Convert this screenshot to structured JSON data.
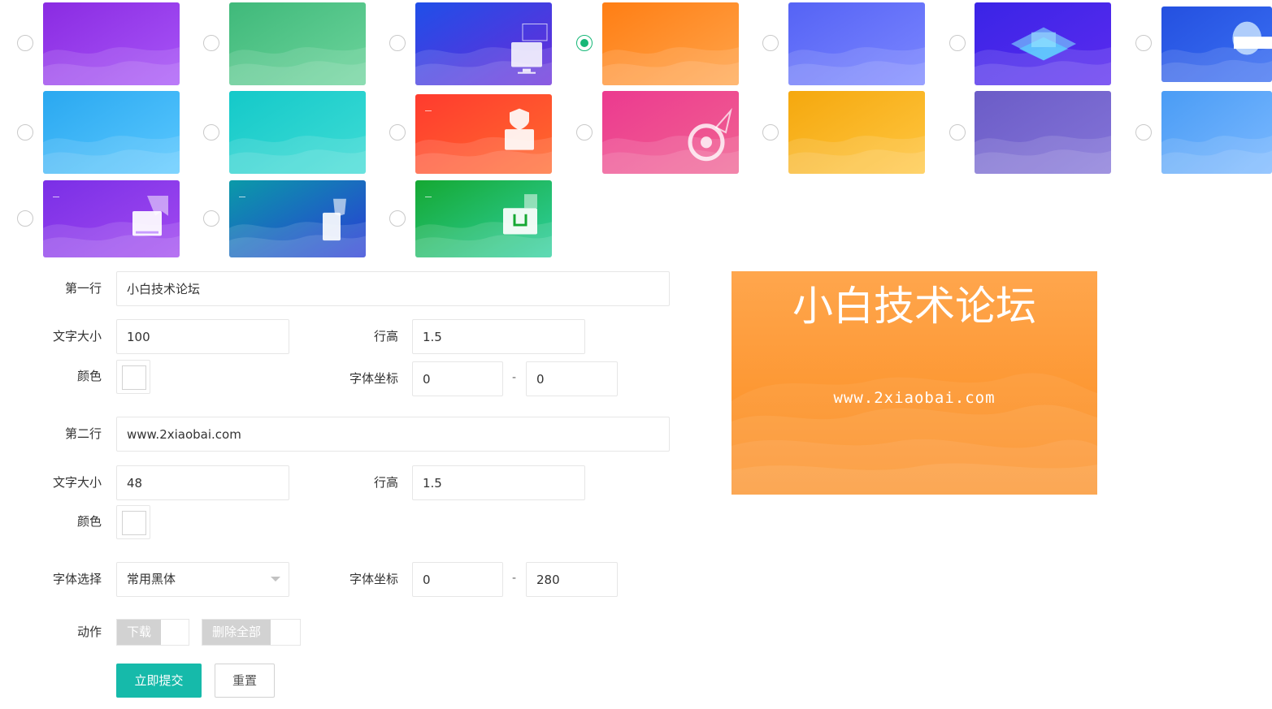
{
  "templates": [
    {
      "id": "t1",
      "theme": "purple-wave",
      "colors": [
        "#8a2be2",
        "#a855f7"
      ],
      "selected": false,
      "icon": "none"
    },
    {
      "id": "t2",
      "theme": "green-wave",
      "colors": [
        "#3fb97a",
        "#6dd49c"
      ],
      "selected": false,
      "icon": "none"
    },
    {
      "id": "t3",
      "theme": "blue-monitor",
      "colors": [
        "#1f4fe8",
        "#6a2bd9"
      ],
      "selected": false,
      "icon": "monitor-icon"
    },
    {
      "id": "t4",
      "theme": "orange-wave",
      "colors": [
        "#ff7e14",
        "#ffa44a"
      ],
      "selected": true,
      "icon": "none"
    },
    {
      "id": "t5",
      "theme": "indigo-wave",
      "colors": [
        "#5563f5",
        "#7b86ff"
      ],
      "selected": false,
      "icon": "none"
    },
    {
      "id": "t6",
      "theme": "blue-isometric",
      "colors": [
        "#3a24e6",
        "#5b2bef"
      ],
      "selected": false,
      "icon": "isometric-icon"
    },
    {
      "id": "t7",
      "theme": "blue-web",
      "colors": [
        "#2450e0",
        "#3a6ff2"
      ],
      "selected": false,
      "icon": "web-icon"
    },
    {
      "id": "t8",
      "theme": "sky-wave",
      "colors": [
        "#2aa8f0",
        "#5ac8ff"
      ],
      "selected": false,
      "icon": "none"
    },
    {
      "id": "t9",
      "theme": "teal-wave",
      "colors": [
        "#14c9c9",
        "#3fdcd5"
      ],
      "selected": false,
      "icon": "none"
    },
    {
      "id": "t10",
      "theme": "red-security",
      "colors": [
        "#ff3b2e",
        "#ff6a2e"
      ],
      "selected": false,
      "icon": "security-icon"
    },
    {
      "id": "t11",
      "theme": "magenta-target",
      "colors": [
        "#ec3a8f",
        "#f06292"
      ],
      "selected": false,
      "icon": "target-icon"
    },
    {
      "id": "t12",
      "theme": "amber-wave",
      "colors": [
        "#f5a80e",
        "#ffc640"
      ],
      "selected": false,
      "icon": "none"
    },
    {
      "id": "t13",
      "theme": "violet-wave",
      "colors": [
        "#6b5cc7",
        "#8474d8"
      ],
      "selected": false,
      "icon": "none"
    },
    {
      "id": "t14",
      "theme": "lightblue-wave",
      "colors": [
        "#4a9cf5",
        "#7ab8ff"
      ],
      "selected": false,
      "icon": "none"
    },
    {
      "id": "t15",
      "theme": "purple-ajax",
      "colors": [
        "#7a2fe6",
        "#a24af0"
      ],
      "selected": false,
      "icon": "ajax-icon"
    },
    {
      "id": "t16",
      "theme": "teal-html5",
      "colors": [
        "#0a9aa8",
        "#2a3bd6"
      ],
      "selected": false,
      "icon": "html5-icon"
    },
    {
      "id": "t17",
      "theme": "green-ui",
      "colors": [
        "#15a832",
        "#2fd0a0"
      ],
      "selected": false,
      "icon": "ui-icon"
    }
  ],
  "form": {
    "line1": {
      "label": "第一行",
      "value": "小白技术论坛",
      "font_size_label": "文字大小",
      "font_size": "100",
      "line_height_label": "行高",
      "line_height": "1.5",
      "color_label": "颜色",
      "color": "#ffffff",
      "coord_label": "字体坐标",
      "coord_x": "0",
      "coord_sep": "-",
      "coord_y": "0"
    },
    "line2": {
      "label": "第二行",
      "value": "www.2xiaobai.com",
      "font_size_label": "文字大小",
      "font_size": "48",
      "line_height_label": "行高",
      "line_height": "1.5",
      "color_label": "颜色",
      "color": "#ffffff"
    },
    "font": {
      "label": "字体选择",
      "selected": "常用黑体",
      "coord_label": "字体坐标",
      "coord_x": "0",
      "coord_sep": "-",
      "coord_y": "280"
    },
    "actions": {
      "label": "动作",
      "download": "下载",
      "delete_all": "删除全部"
    },
    "submit": "立即提交",
    "reset": "重置"
  },
  "preview": {
    "line1": "小白技术论坛",
    "line2": "www.2xiaobai.com",
    "background": [
      "#ffa64d",
      "#fb8c1e"
    ],
    "text_color": "#ffffff"
  },
  "accent_color": "#16baaa",
  "radio_checked_color": "#16b777"
}
